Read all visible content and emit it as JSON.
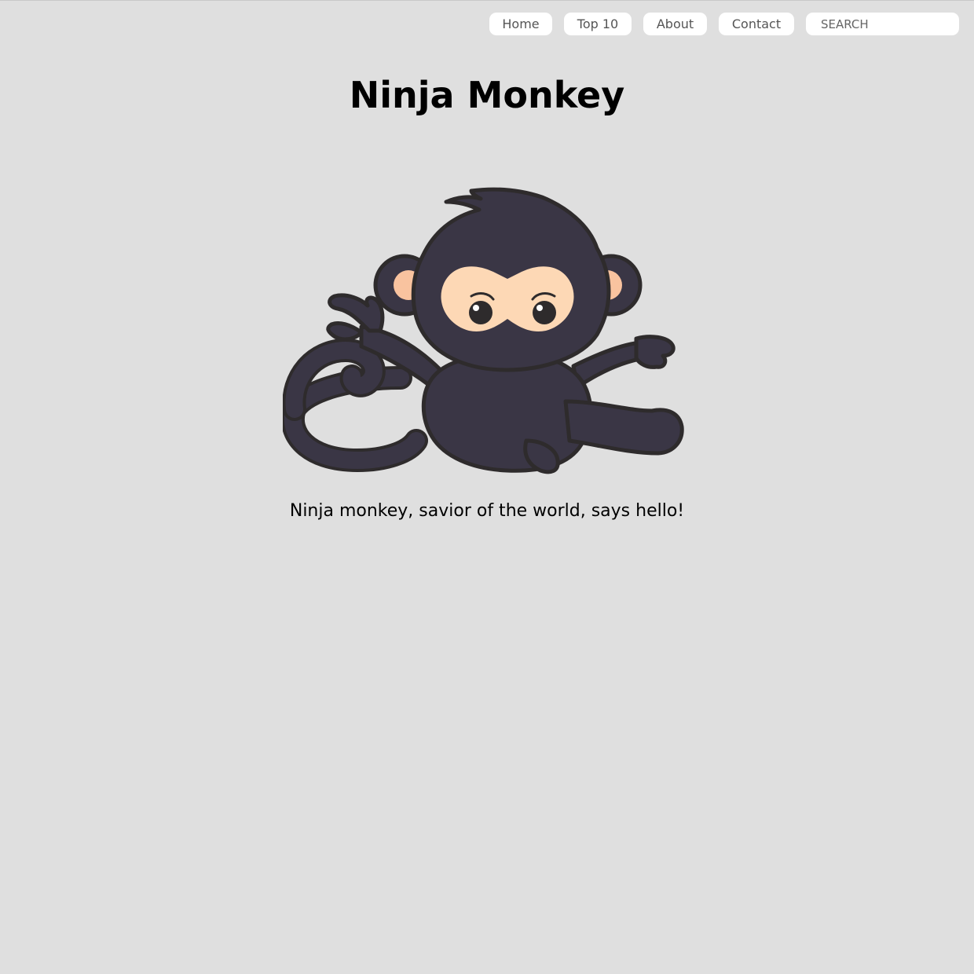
{
  "nav": {
    "items": [
      {
        "label": "Home"
      },
      {
        "label": "Top 10"
      },
      {
        "label": "About"
      },
      {
        "label": "Contact"
      }
    ],
    "search": {
      "placeholder": "SEARCH",
      "value": ""
    }
  },
  "main": {
    "title": "Ninja Monkey",
    "caption": "Ninja monkey, savior of the world, says hello!"
  },
  "colors": {
    "background": "#dfdfdf",
    "button": "#ffffff",
    "ninja_body": "#3a3645",
    "skin": "#fdd8b5",
    "ear_inner": "#f9c39f",
    "outline": "#2e2b2c"
  }
}
